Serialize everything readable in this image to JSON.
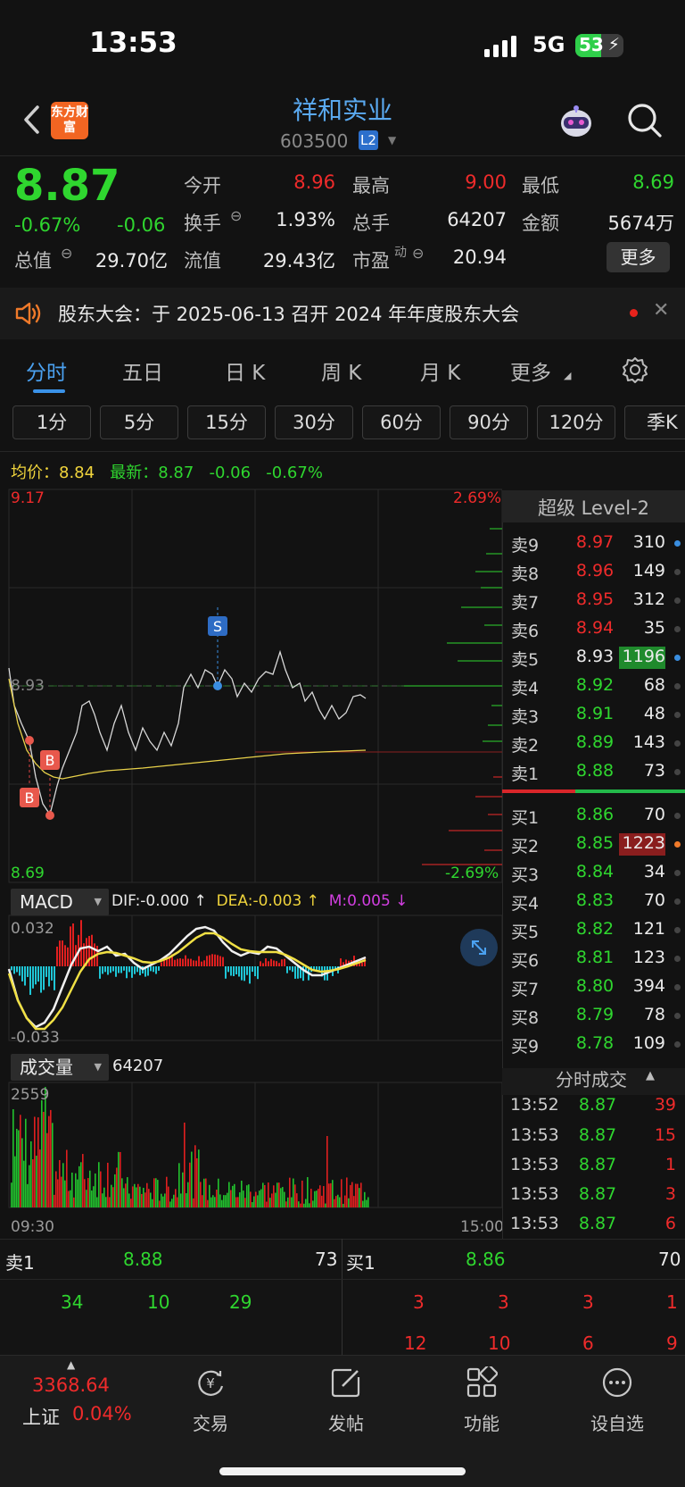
{
  "status": {
    "time": "13:53",
    "network": "5G",
    "battery": "53",
    "battery_level": 0.53
  },
  "header": {
    "logo": "东方财富",
    "name": "祥和实业",
    "code": "603500",
    "badge": "L2"
  },
  "quote": {
    "price": "8.87",
    "change_pct": "-0.67%",
    "change": "-0.06",
    "open_label": "今开",
    "open": "8.96",
    "high_label": "最高",
    "high": "9.00",
    "low_label": "最低",
    "low": "8.69",
    "turnover_label": "换手",
    "turnover": "1.93%",
    "volume_label": "总手",
    "volume": "64207",
    "amount_label": "金额",
    "amount": "5674万",
    "mktcap_label": "总值",
    "mktcap": "29.70亿",
    "float_label": "流值",
    "float_cap": "29.43亿",
    "pe_label": "市盈",
    "pe_sup": "动",
    "pe": "20.94",
    "more": "更多"
  },
  "notice": {
    "text": "股东大会：于 2025-06-13 召开 2024 年年度股东大会"
  },
  "tabs": [
    "分时",
    "五日",
    "日 K",
    "周 K",
    "月 K",
    "更多"
  ],
  "periods": [
    "1分",
    "5分",
    "15分",
    "30分",
    "60分",
    "90分",
    "120分",
    "季K"
  ],
  "avg_line": {
    "avg_label": "均价：",
    "avg": "8.84",
    "last_label": "最新：",
    "last": "8.87",
    "change": "-0.06",
    "pct": "-0.67%"
  },
  "chart_axes": {
    "price_high": "9.17",
    "price_low": "8.69",
    "pct_high": "2.69%",
    "pct_low": "-2.69%",
    "ref_price": "8.93",
    "start_time": "09:30",
    "end_time": "15:00",
    "marker_s": "S",
    "marker_b": "B"
  },
  "macd": {
    "label": "MACD",
    "dif": "DIF:-0.000 ↑",
    "dea": "DEA:-0.003 ↑",
    "m": "M:0.005 ↓",
    "top": "0.032",
    "bottom": "-0.033"
  },
  "volume_panel": {
    "label": "成交量",
    "value": "64207",
    "max": "2559"
  },
  "order_book": {
    "title": "超级 Level-2",
    "asks": [
      {
        "label": "卖9",
        "price": "8.97",
        "vol": "310",
        "pc": "red"
      },
      {
        "label": "卖8",
        "price": "8.96",
        "vol": "149",
        "pc": "red"
      },
      {
        "label": "卖7",
        "price": "8.95",
        "vol": "312",
        "pc": "red"
      },
      {
        "label": "卖6",
        "price": "8.94",
        "vol": "35",
        "pc": "red"
      },
      {
        "label": "卖5",
        "price": "8.93",
        "vol": "1196",
        "pc": "white"
      },
      {
        "label": "卖4",
        "price": "8.92",
        "vol": "68",
        "pc": "green"
      },
      {
        "label": "卖3",
        "price": "8.91",
        "vol": "48",
        "pc": "green"
      },
      {
        "label": "卖2",
        "price": "8.89",
        "vol": "143",
        "pc": "green"
      },
      {
        "label": "卖1",
        "price": "8.88",
        "vol": "73",
        "pc": "green"
      }
    ],
    "bids": [
      {
        "label": "买1",
        "price": "8.86",
        "vol": "70"
      },
      {
        "label": "买2",
        "price": "8.85",
        "vol": "1223"
      },
      {
        "label": "买3",
        "price": "8.84",
        "vol": "34"
      },
      {
        "label": "买4",
        "price": "8.83",
        "vol": "70"
      },
      {
        "label": "买5",
        "price": "8.82",
        "vol": "121"
      },
      {
        "label": "买6",
        "price": "8.81",
        "vol": "123"
      },
      {
        "label": "买7",
        "price": "8.80",
        "vol": "394"
      },
      {
        "label": "买8",
        "price": "8.79",
        "vol": "78"
      },
      {
        "label": "买9",
        "price": "8.78",
        "vol": "109"
      }
    ]
  },
  "ticks": {
    "title": "分时成交",
    "rows": [
      {
        "time": "13:52",
        "price": "8.87",
        "vol": "39"
      },
      {
        "time": "13:53",
        "price": "8.87",
        "vol": "15"
      },
      {
        "time": "13:53",
        "price": "8.87",
        "vol": "1"
      },
      {
        "time": "13:53",
        "price": "8.87",
        "vol": "3"
      },
      {
        "time": "13:53",
        "price": "8.87",
        "vol": "6"
      }
    ]
  },
  "summary": {
    "ask_label": "卖1",
    "ask_price": "8.88",
    "ask_vol": "73",
    "bid_label": "买1",
    "bid_price": "8.86",
    "bid_vol": "70",
    "ask_queue": [
      "34",
      "10",
      "29"
    ],
    "bid_queue_1": [
      "3",
      "3",
      "3",
      "1"
    ],
    "bid_queue_2": [
      "12",
      "10",
      "6",
      "9"
    ]
  },
  "tabbar": {
    "index_value": "3368.64",
    "index_name": "上证",
    "index_pct": "0.04%",
    "items": [
      "交易",
      "发帖",
      "功能",
      "设自选"
    ]
  },
  "colors": {
    "up": "#ef2b2b",
    "down": "#2fd62f",
    "accent": "#4ba1f0"
  }
}
